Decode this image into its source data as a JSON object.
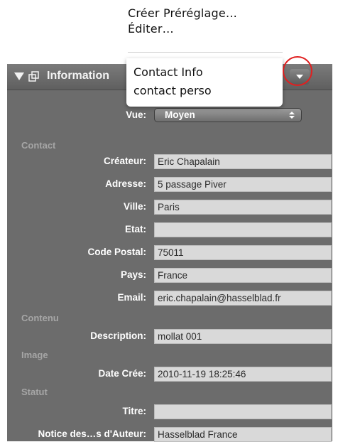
{
  "top_menu": {
    "items": [
      "Créer Préréglage…",
      "Éditer…"
    ]
  },
  "panel": {
    "title": "Information",
    "popup_items": [
      "Contact Info",
      "contact perso"
    ]
  },
  "view": {
    "label": "Vue:",
    "value": "Moyen"
  },
  "sections": {
    "contact": "Contact",
    "contenu": "Contenu",
    "image": "Image",
    "statut": "Statut"
  },
  "fields": {
    "createur": {
      "label": "Créateur:",
      "value": "Eric Chapalain"
    },
    "adresse": {
      "label": "Adresse:",
      "value": "5 passage Piver"
    },
    "ville": {
      "label": "Ville:",
      "value": "Paris"
    },
    "etat": {
      "label": "Etat:",
      "value": ""
    },
    "code_postal": {
      "label": "Code Postal:",
      "value": "75011"
    },
    "pays": {
      "label": "Pays:",
      "value": "France"
    },
    "email": {
      "label": "Email:",
      "value": "eric.chapalain@hasselblad.fr"
    },
    "description": {
      "label": "Description:",
      "value": "mollat 001"
    },
    "date_cree": {
      "label": "Date Crée:",
      "value": "2010-11-19 18:25:46"
    },
    "titre": {
      "label": "Titre:",
      "value": ""
    },
    "notice": {
      "label": "Notice des…s d'Auteur:",
      "value": "Hasselblad France"
    }
  },
  "colors": {
    "panel_bg": "#6c6c6c",
    "field_bg": "#d9d9d9",
    "section_label": "#a6a6a6",
    "highlight_circle": "#e02020"
  }
}
